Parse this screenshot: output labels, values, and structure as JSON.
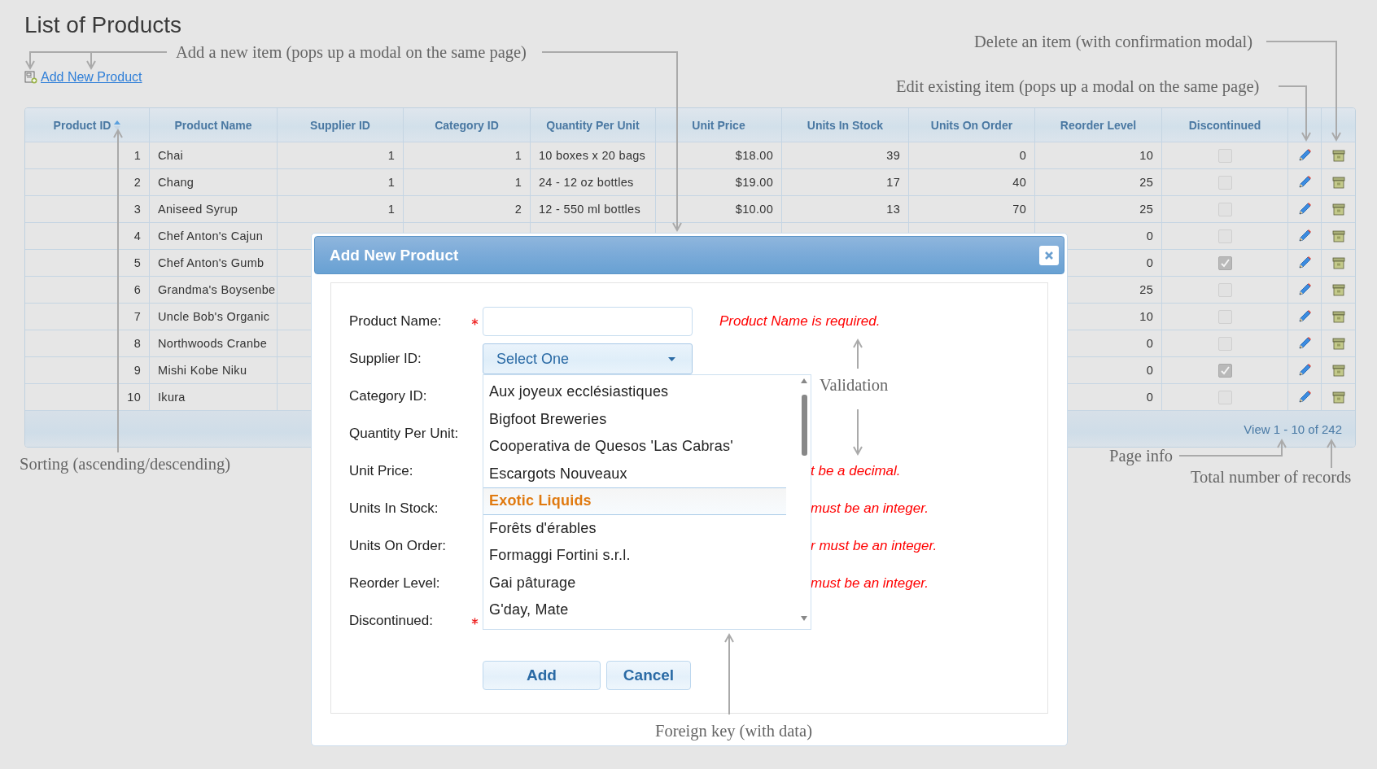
{
  "page": {
    "title": "List of Products",
    "add_link": "Add New Product"
  },
  "table": {
    "columns": [
      {
        "label": "Product ID",
        "sorted": true
      },
      {
        "label": "Product Name",
        "sorted": false
      },
      {
        "label": "Supplier ID",
        "sorted": false
      },
      {
        "label": "Category ID",
        "sorted": false
      },
      {
        "label": "Quantity Per Unit",
        "sorted": false
      },
      {
        "label": "Unit Price",
        "sorted": false
      },
      {
        "label": "Units In Stock",
        "sorted": false
      },
      {
        "label": "Units On Order",
        "sorted": false
      },
      {
        "label": "Reorder Level",
        "sorted": false
      },
      {
        "label": "Discontinued",
        "sorted": false
      }
    ],
    "rows": [
      {
        "cells": [
          "1",
          "Chai",
          "1",
          "1",
          "10 boxes x 20 bags",
          "$18.00",
          "39",
          "0",
          "10"
        ],
        "discontinued": false
      },
      {
        "cells": [
          "2",
          "Chang",
          "1",
          "1",
          "24 - 12 oz bottles",
          "$19.00",
          "17",
          "40",
          "25"
        ],
        "discontinued": false
      },
      {
        "cells": [
          "3",
          "Aniseed Syrup",
          "1",
          "2",
          "12 - 550 ml bottles",
          "$10.00",
          "13",
          "70",
          "25"
        ],
        "discontinued": false
      },
      {
        "cells": [
          "4",
          "Chef Anton's Cajun",
          null,
          null,
          null,
          null,
          null,
          null,
          "0"
        ],
        "discontinued": false
      },
      {
        "cells": [
          "5",
          "Chef Anton's Gumb",
          null,
          null,
          null,
          null,
          null,
          null,
          "0"
        ],
        "discontinued": true
      },
      {
        "cells": [
          "6",
          "Grandma's Boysenbe",
          null,
          null,
          null,
          null,
          null,
          null,
          "25"
        ],
        "discontinued": false
      },
      {
        "cells": [
          "7",
          "Uncle Bob's Organic",
          null,
          null,
          null,
          null,
          null,
          null,
          "10"
        ],
        "discontinued": false
      },
      {
        "cells": [
          "8",
          "Northwoods Cranbe",
          null,
          null,
          null,
          null,
          null,
          null,
          "0"
        ],
        "discontinued": false
      },
      {
        "cells": [
          "9",
          "Mishi Kobe Niku",
          null,
          null,
          null,
          null,
          null,
          null,
          "0"
        ],
        "discontinued": true
      },
      {
        "cells": [
          "10",
          "Ikura",
          null,
          null,
          null,
          null,
          null,
          null,
          "0"
        ],
        "discontinued": false
      }
    ],
    "page_info": "View 1 - 10 of 242"
  },
  "modal": {
    "title": "Add New Product",
    "fields": [
      {
        "label": "Product Name:",
        "required": true,
        "input": {
          "kind": "text"
        },
        "error": "Product Name is required."
      },
      {
        "label": "Supplier ID:",
        "required": false,
        "input": {
          "kind": "select",
          "value": "Select One",
          "expanded": true,
          "options": [
            {
              "label": "Aux joyeux ecclésiastiques",
              "selected": false
            },
            {
              "label": "Bigfoot Breweries",
              "selected": false
            },
            {
              "label": "Cooperativa de Quesos 'Las Cabras'",
              "selected": false
            },
            {
              "label": "Escargots Nouveaux",
              "selected": false
            },
            {
              "label": "Exotic Liquids",
              "selected": true
            },
            {
              "label": "Forêts d'érables",
              "selected": false
            },
            {
              "label": "Formaggi Fortini s.r.l.",
              "selected": false
            },
            {
              "label": "Gai pâturage",
              "selected": false
            },
            {
              "label": "G'day, Mate",
              "selected": false
            }
          ]
        }
      },
      {
        "label": "Category ID:",
        "required": false
      },
      {
        "label": "Quantity Per Unit:",
        "required": false
      },
      {
        "label": "Unit Price:",
        "required": false,
        "error": "t be a decimal."
      },
      {
        "label": "Units In Stock:",
        "required": false,
        "error": "must be an integer."
      },
      {
        "label": "Units On Order:",
        "required": false,
        "error": "r must be an integer."
      },
      {
        "label": "Reorder Level:",
        "required": false,
        "error": "must be an integer."
      },
      {
        "label": "Discontinued:",
        "required": true
      }
    ],
    "buttons": [
      "Add",
      "Cancel"
    ]
  },
  "annotations": [
    {
      "text": "Add a new item (pops up a modal on the same page)"
    },
    {
      "text": "Delete an item (with confirmation modal)"
    },
    {
      "text": "Edit existing item (pops up a modal on the same page)"
    },
    {
      "text": "Sorting (ascending/descending)"
    },
    {
      "text": "Validation"
    },
    {
      "text": "Page info"
    },
    {
      "text": "Total number of records"
    },
    {
      "text": "Foreign key (with data)"
    }
  ]
}
